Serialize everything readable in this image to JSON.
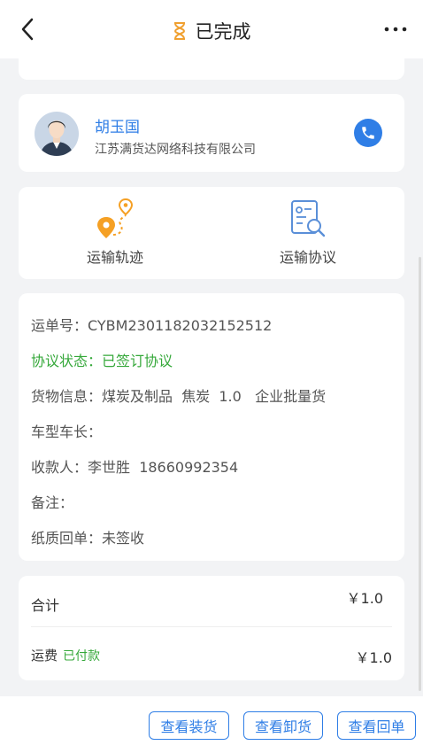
{
  "header": {
    "title": "已完成"
  },
  "contact": {
    "name": "胡玉国",
    "company": "江苏满货达网络科技有限公司"
  },
  "actions": [
    {
      "label": "运输轨迹"
    },
    {
      "label": "运输协议"
    }
  ],
  "details": {
    "waybill_key": "运单号：",
    "waybill_val": "CYBM2301182032152512",
    "status_key": "协议状态：",
    "status_val": "已签订协议",
    "goods_key": "货物信息：",
    "goods_val": "煤炭及制品  焦炭  1.0   企业批量货",
    "vehicle_key": "车型车长：",
    "vehicle_val": "",
    "payee_key": "收款人：",
    "payee_val": "李世胜  18660992354",
    "remark_key": "备注：",
    "remark_val": "",
    "receipt_key": "纸质回单：",
    "receipt_val": "未签收"
  },
  "totals": {
    "total_label": "合计",
    "total_amount": "￥1.0",
    "freight_label": "运费",
    "freight_status": "已付款",
    "freight_amount": "￥1.0"
  },
  "buttons": {
    "view_loading": "查看装货",
    "view_unloading": "查看卸货",
    "view_receipt": "查看回单"
  },
  "colors": {
    "accent": "#2f7ee6",
    "success": "#35a83a",
    "status_icon": "#f0a030",
    "route_icon": "#f5a024"
  },
  "icons": {
    "back": "chevron-left-icon",
    "status": "hourglass-icon",
    "more": "more-dots-icon",
    "phone": "phone-icon",
    "route": "route-pin-icon",
    "agreement": "document-search-icon"
  }
}
